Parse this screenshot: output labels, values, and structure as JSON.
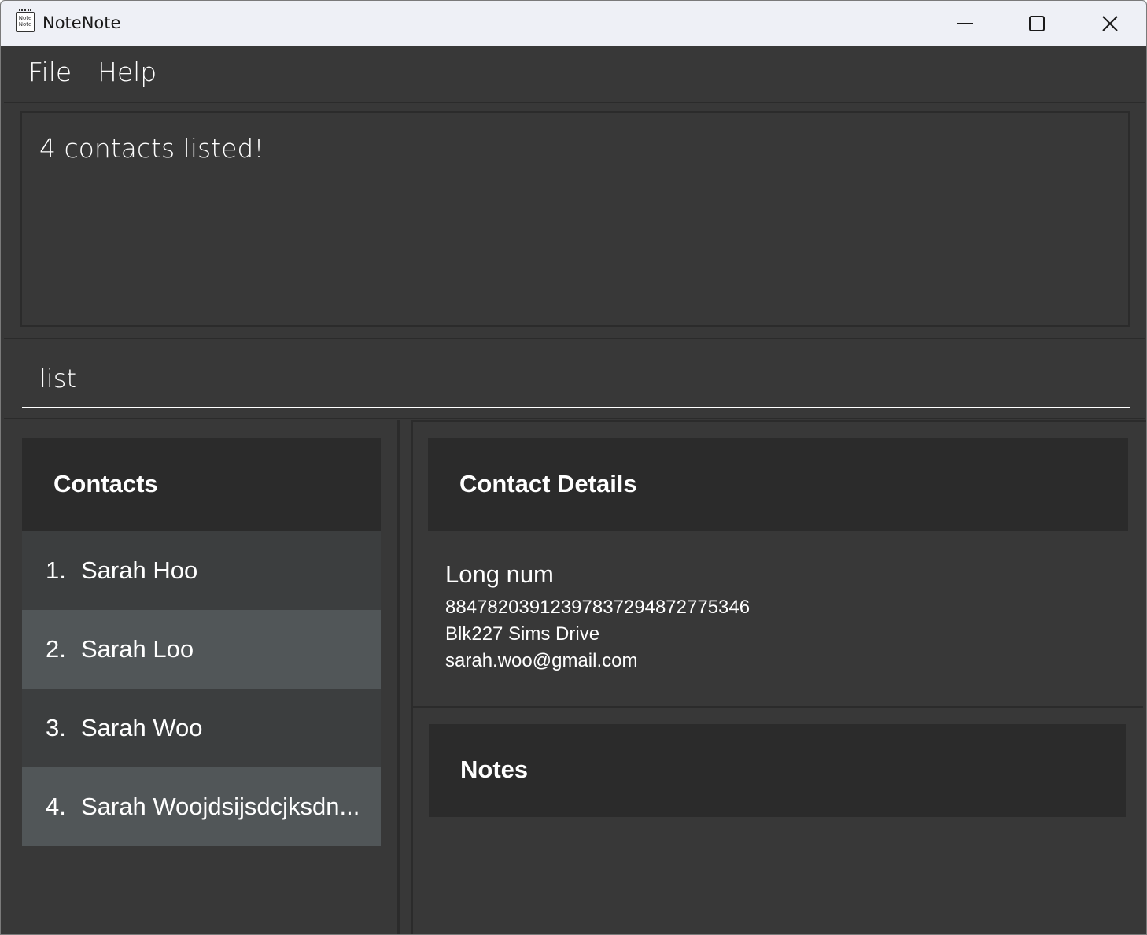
{
  "window": {
    "title": "NoteNote",
    "icon_label": "Note Note"
  },
  "menu": {
    "items": [
      "File",
      "Help"
    ]
  },
  "result": {
    "message": "4 contacts listed!"
  },
  "command": {
    "value": "list"
  },
  "contacts": {
    "header": "Contacts",
    "items": [
      {
        "index": "1.",
        "name": "Sarah Hoo"
      },
      {
        "index": "2.",
        "name": "Sarah Loo"
      },
      {
        "index": "3.",
        "name": "Sarah Woo"
      },
      {
        "index": "4.",
        "name": "Sarah Woojdsijsdcjksdn..."
      }
    ]
  },
  "details": {
    "header": "Contact Details",
    "name": "Long num",
    "phone": "884782039123978372948727753​46",
    "address": "Blk227 Sims Drive",
    "email": "sarah.woo@gmail.com"
  },
  "notes": {
    "header": "Notes"
  },
  "colors": {
    "background": "#383838",
    "header_bg": "#2b2b2b",
    "row_odd": "#3c3e3f",
    "row_even": "#515658",
    "titlebar": "#eef0f6"
  }
}
